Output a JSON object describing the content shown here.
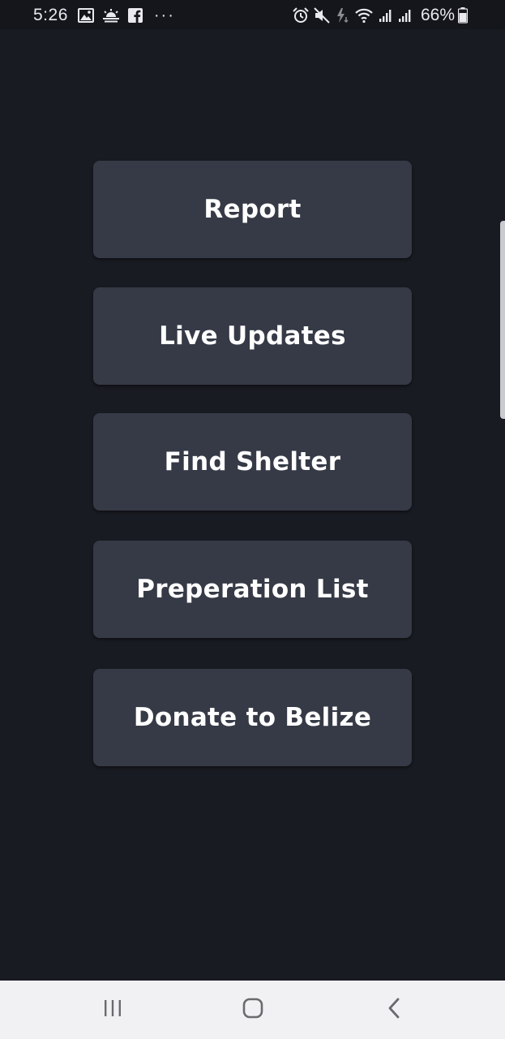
{
  "status_bar": {
    "time": "5:26",
    "left_icons": [
      "gallery-icon",
      "weather-icon",
      "facebook-icon"
    ],
    "more_indicator": "···",
    "right_icons": [
      "alarm-icon",
      "mute-icon",
      "data-saver-icon",
      "wifi-icon",
      "signal-icon",
      "signal-icon"
    ],
    "battery_percent": "66%"
  },
  "menu": {
    "buttons": [
      {
        "label": "Report"
      },
      {
        "label": "Live Updates"
      },
      {
        "label": "Find Shelter"
      },
      {
        "label": "Preperation List"
      },
      {
        "label": "Donate to Belize"
      }
    ]
  },
  "nav_bar": {
    "buttons": [
      "recent-apps-icon",
      "home-icon",
      "back-icon"
    ]
  },
  "colors": {
    "background": "#181b22",
    "button": "#363a46",
    "text": "#ffffff",
    "nav_background": "#f1f1f3"
  }
}
